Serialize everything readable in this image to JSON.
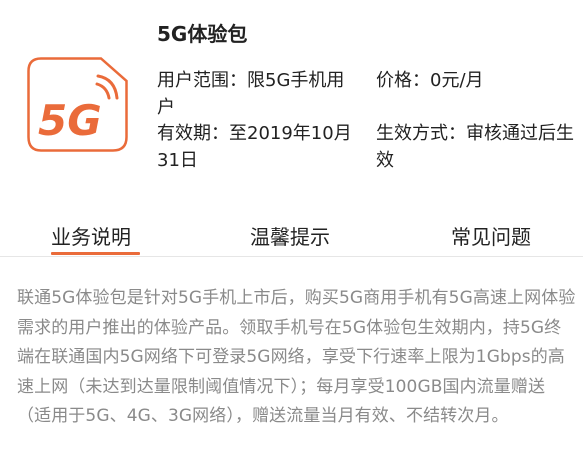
{
  "product": {
    "title": "5G体验包",
    "logo_text": "5G",
    "logo_icon": "5g-signal-card-icon",
    "brand_color": "#ea6b3a",
    "scope": "用户范围：限5G手机用户",
    "price": "价格：0元/月",
    "validity": "有效期：至2019年10月31日",
    "activation": "生效方式：审核通过后生效"
  },
  "tabs": {
    "active": "业务说明",
    "business": "业务说明",
    "tips": "温馨提示",
    "faq": "常见问题"
  },
  "content": {
    "description": "联通5G体验包是针对5G手机上市后，购买5G商用手机有5G高速上网体验需求的用户推出的体验产品。领取手机号在5G体验包生效期内，持5G终端在联通国内5G网络下可登录5G网络，享受下行速率上限为1Gbps的高速上网（未达到达量限制阈值情况下）；每月享受100GB国内流量赠送（适用于5G、4G、3G网络），赠送流量当月有效、不结转次月。"
  }
}
